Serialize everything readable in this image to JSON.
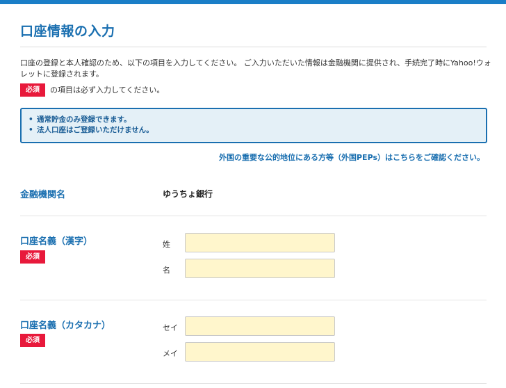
{
  "page_title": "口座情報の入力",
  "intro": {
    "text": "口座の登録と本人確認のため、以下の項目を入力してください。 ご入力いただいた情報は金融機関に提供され、手続完了時にYahoo!ウォレットに登録されます。",
    "required_badge": "必須",
    "required_note": "の項目は必ず入力してください。"
  },
  "notice": {
    "items": [
      "通常貯金のみ登録できます。",
      "法人口座はご登録いただけません。"
    ]
  },
  "peps_link": "外国の重要な公的地位にある方等（外国PEPs）はこちらをご確認ください。",
  "fields": {
    "bank": {
      "label": "金融機関名",
      "value": "ゆうちょ銀行"
    },
    "name_kanji": {
      "label": "口座名義（漢字）",
      "badge": "必須",
      "sei_label": "姓",
      "mei_label": "名",
      "sei_value": "",
      "mei_value": ""
    },
    "name_kana": {
      "label": "口座名義（カタカナ）",
      "badge": "必須",
      "sei_label": "セイ",
      "mei_label": "メイ",
      "sei_value": "",
      "mei_value": ""
    }
  },
  "colors": {
    "accent": "#1a6fb0",
    "required": "#e8193b",
    "notice_bg": "#e4f0f7",
    "input_bg": "#fff6cc"
  }
}
